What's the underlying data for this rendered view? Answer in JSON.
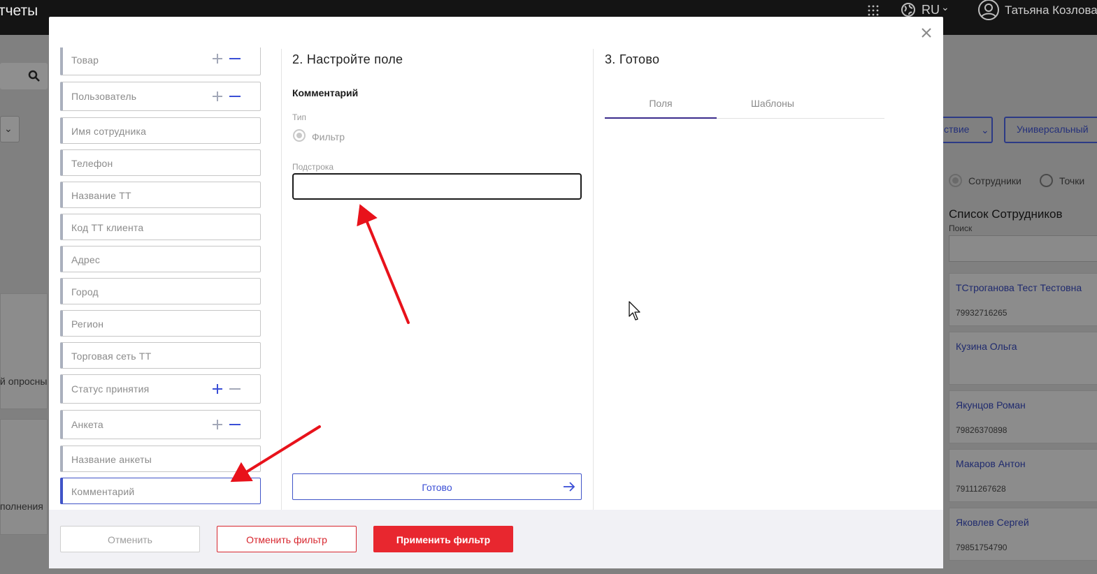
{
  "topbar": {
    "title": "тчеты",
    "language": "RU",
    "user_name": "Татьяна Козлова"
  },
  "background": {
    "mode_left_btn": "ствие",
    "mode_right_btn": "Универсальный",
    "radio_employees": "Сотрудники",
    "radio_points": "Точки",
    "list_title": "Список Сотрудников",
    "search_label": "Поиск",
    "left_text_1": "й опросны",
    "left_text_2": "полнения",
    "employees": [
      {
        "name": "ТСтроганова Тест Тестовна",
        "phone": "79932716265"
      },
      {
        "name": "Кузина Ольга",
        "phone": ""
      },
      {
        "name": "Якунцов Роман",
        "phone": "79826370898"
      },
      {
        "name": "Макаров Антон",
        "phone": "79111267628"
      },
      {
        "name": "Яковлев Сергей",
        "phone": "79851754790"
      }
    ]
  },
  "modal": {
    "fields": [
      {
        "label": "Товар",
        "controls": "minus-active"
      },
      {
        "label": "Пользователь",
        "controls": "minus-active"
      },
      {
        "label": "Имя сотрудника",
        "controls": "none"
      },
      {
        "label": "Телефон",
        "controls": "none"
      },
      {
        "label": "Название ТТ",
        "controls": "none"
      },
      {
        "label": "Код ТТ клиента",
        "controls": "none"
      },
      {
        "label": "Адрес",
        "controls": "none"
      },
      {
        "label": "Город",
        "controls": "none"
      },
      {
        "label": "Регион",
        "controls": "none"
      },
      {
        "label": "Торговая сеть ТТ",
        "controls": "none"
      },
      {
        "label": "Статус принятия",
        "controls": "plus-active"
      },
      {
        "label": "Анкета",
        "controls": "minus-active"
      },
      {
        "label": "Название анкеты",
        "controls": "none"
      },
      {
        "label": "Комментарий",
        "controls": "none",
        "active": true
      }
    ],
    "configure": {
      "title": "2. Настройте поле",
      "field_name": "Комментарий",
      "type_label": "Тип",
      "type_value": "Фильтр",
      "substring_label": "Подстрока",
      "substring_value": "",
      "done_label": "Готово"
    },
    "ready": {
      "title": "3. Готово",
      "tabs": [
        "Поля",
        "Шаблоны"
      ],
      "active_tab": "Поля"
    },
    "footer": {
      "cancel": "Отменить",
      "reset_filter": "Отменить фильтр",
      "apply_filter": "Применить фильтр"
    }
  },
  "colors": {
    "accent_blue": "#3b4fd6",
    "danger_red": "#e8272f",
    "annotation_red": "#e8121b",
    "topbar_bg": "#141414"
  }
}
